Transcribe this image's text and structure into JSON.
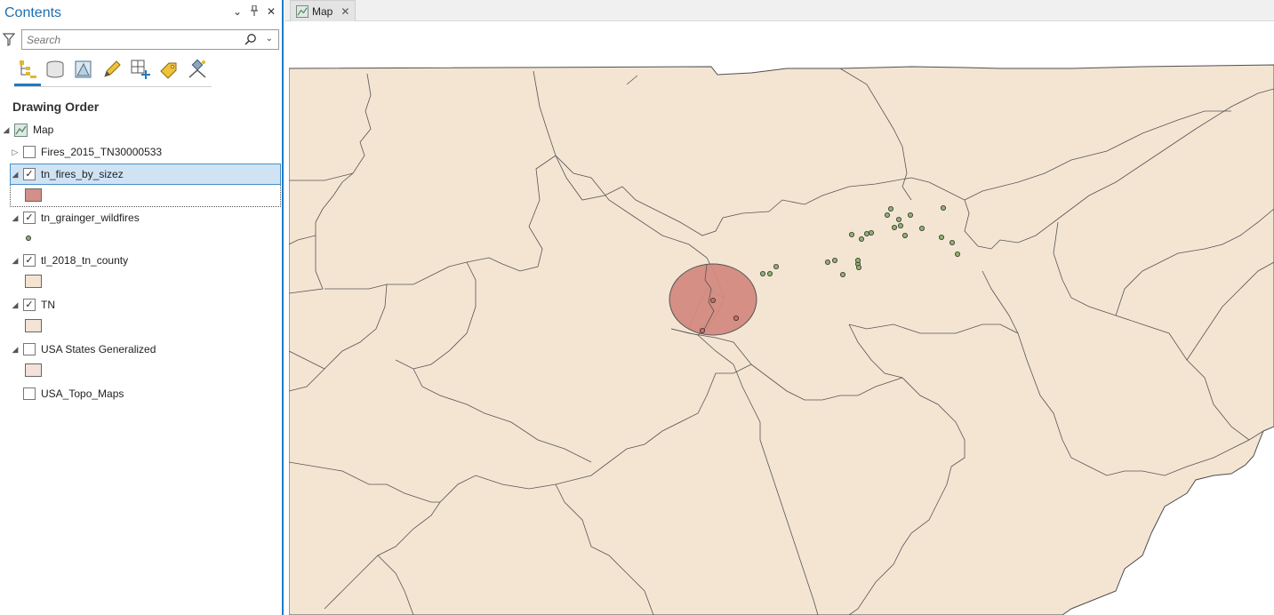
{
  "contents": {
    "title": "Contents",
    "controls": {
      "dropdown": "⌄",
      "pin": "📌",
      "close": "✕"
    },
    "search": {
      "placeholder": "Search",
      "value": ""
    },
    "section_title": "Drawing Order",
    "map_label": "Map",
    "layers": [
      {
        "label": "Fires_2015_TN30000533",
        "checked": false,
        "expanded": false
      },
      {
        "label": "tn_fires_by_sizez",
        "checked": true,
        "expanded": true,
        "selected": true,
        "symbol": "swatch",
        "symbol_color": "#d38f89"
      },
      {
        "label": "tn_grainger_wildfires",
        "checked": true,
        "expanded": true,
        "symbol": "point",
        "symbol_color": "#8fb36e"
      },
      {
        "label": "tl_2018_tn_county",
        "checked": true,
        "expanded": true,
        "symbol": "swatch",
        "symbol_color": "#f3e4d2"
      },
      {
        "label": "TN",
        "checked": true,
        "expanded": true,
        "symbol": "swatch",
        "symbol_color": "#f3e4d8"
      },
      {
        "label": "USA States Generalized",
        "checked": false,
        "expanded": true,
        "symbol": "swatch",
        "symbol_color": "#f3e2da"
      },
      {
        "label": "USA_Topo_Maps",
        "checked": false,
        "expanded": false
      }
    ],
    "check_glyph": "✓",
    "expanded_glyph": "◢",
    "collapsed_glyph": "▷"
  },
  "map_tab": {
    "label": "Map",
    "close": "✕"
  },
  "colors": {
    "accent": "#1e7bc4",
    "land_fill": "#f4e5d3",
    "boundary": "#555555",
    "fire_buffer": "#d38a80",
    "fire_point": "#8fb36e"
  },
  "icons": [
    "filter-icon",
    "search-icon",
    "list-by-drawing-order-icon",
    "list-by-data-source-icon",
    "list-by-selection-icon",
    "list-by-editing-icon",
    "list-by-snapping-icon",
    "list-by-labeling-icon",
    "list-by-perspective-imagery-icon"
  ]
}
